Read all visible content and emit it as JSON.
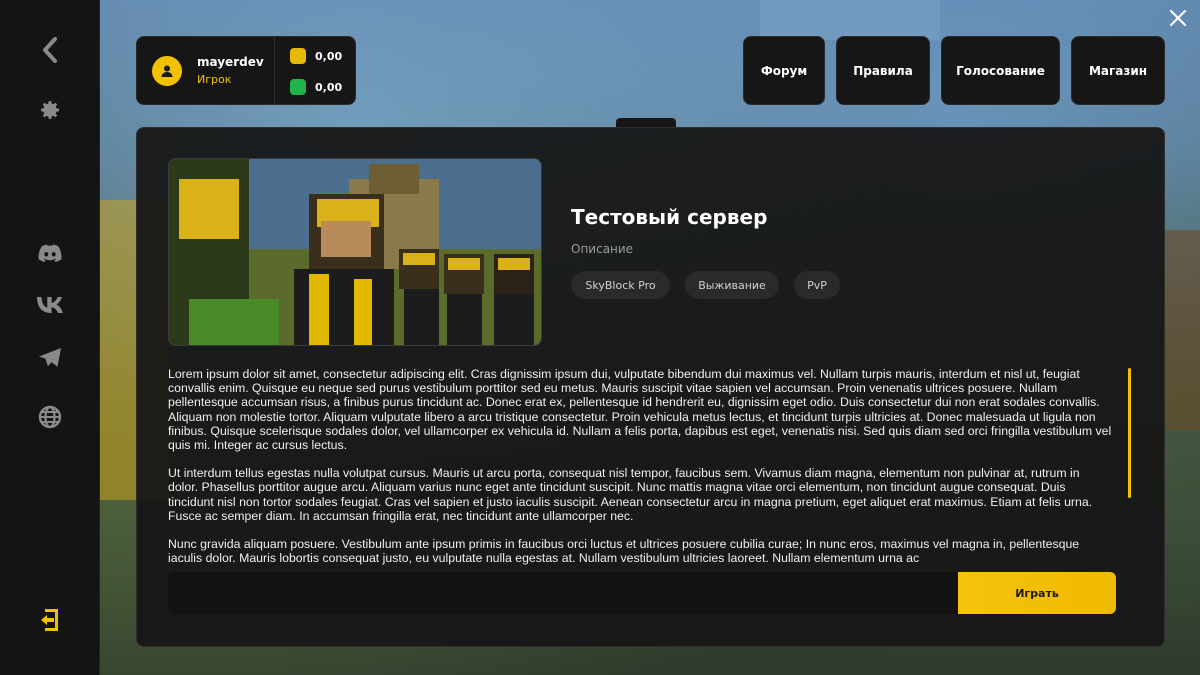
{
  "user": {
    "name": "mayerdev",
    "role": "Игрок",
    "gold_balance": "0,00",
    "green_balance": "0,00"
  },
  "nav": {
    "forum": "Форум",
    "rules": "Правила",
    "vote": "Голосование",
    "shop": "Магазин"
  },
  "server": {
    "title": "Тестовый сервер",
    "description_label": "Описание",
    "tags": [
      "SkyBlock Pro",
      "Выживание",
      "PvP"
    ],
    "paragraphs": [
      "Lorem ipsum dolor sit amet, consectetur adipiscing elit. Cras dignissim ipsum dui, vulputate bibendum dui maximus vel. Nullam turpis mauris, interdum et nisl ut, feugiat convallis enim. Quisque eu neque sed purus vestibulum porttitor sed eu metus. Mauris suscipit vitae sapien vel accumsan. Proin venenatis ultrices posuere. Nullam pellentesque accumsan risus, a finibus purus tincidunt ac. Donec erat ex, pellentesque id hendrerit eu, dignissim eget odio. Duis consectetur dui non erat sodales convallis. Aliquam non molestie tortor. Aliquam vulputate libero a arcu tristique consectetur. Proin vehicula metus lectus, et tincidunt turpis ultricies at. Donec malesuada ut ligula non finibus. Quisque scelerisque sodales dolor, vel ullamcorper ex vehicula id. Nullam a felis porta, dapibus est eget, venenatis nisi. Sed quis diam sed orci fringilla vestibulum vel quis mi. Integer ac cursus lectus.",
      "Ut interdum tellus egestas nulla volutpat cursus. Mauris ut arcu porta, consequat nisl tempor, faucibus sem. Vivamus diam magna, elementum non pulvinar at, rutrum in dolor. Phasellus porttitor augue arcu. Aliquam varius nunc eget ante tincidunt suscipit. Nunc mattis magna vitae orci elementum, non tincidunt augue consequat. Duis tincidunt nisl non tortor sodales feugiat. Cras vel sapien et justo iaculis suscipit. Aenean consectetur arcu in magna pretium, eget aliquet erat maximus. Etiam at felis urna. Fusce ac semper diam. In accumsan fringilla erat, nec tincidunt ante ullamcorper nec.",
      "Nunc gravida aliquam posuere. Vestibulum ante ipsum primis in faucibus orci luctus et ultrices posuere cubilia curae; In nunc eros, maximus vel magna in, pellentesque iaculis dolor. Mauris lobortis consequat justo, eu vulputate nulla egestas at. Nullam vestibulum ultricies laoreet. Nullam elementum urna ac"
    ],
    "play_label": "Играть"
  },
  "icons": {
    "back": "chevron-left-icon",
    "settings": "gear-icon",
    "discord": "discord-icon",
    "vk": "vk-icon",
    "telegram": "telegram-icon",
    "website": "globe-icon",
    "exit": "exit-icon",
    "close": "close-icon",
    "accent_color": "#f2c200"
  }
}
